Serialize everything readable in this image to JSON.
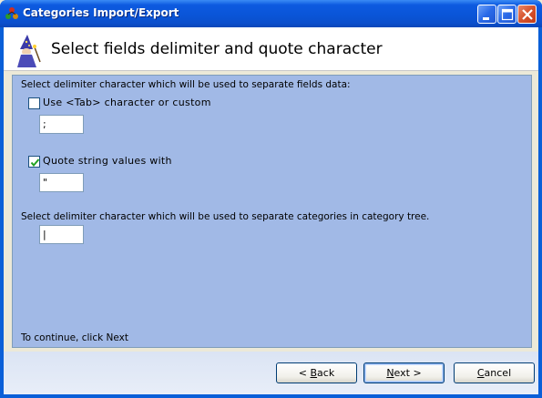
{
  "window": {
    "title": "Categories Import/Export",
    "icons": {
      "app": "tree-app-icon",
      "minimize": "minimize-icon",
      "maximize": "maximize-icon",
      "close": "close-icon"
    }
  },
  "header": {
    "title": "Select fields delimiter and quote character",
    "icon": "wizard-icon"
  },
  "form": {
    "fields_delimiter_label": "Select delimiter character which will be used to separate fields data:",
    "use_tab_label": "Use <Tab> character or custom",
    "use_tab_checked": false,
    "custom_delimiter_value": ";",
    "quote_label": "Quote string values with",
    "quote_checked": true,
    "quote_value": "\"",
    "category_delimiter_label": "Select delimiter character which will be used to separate categories in category tree.",
    "category_delimiter_value": "|",
    "continue_hint": "To continue, click Next"
  },
  "buttons": {
    "back_prefix": "< ",
    "back_key": "B",
    "back_rest": "ack",
    "next_key": "N",
    "next_rest": "ext >",
    "cancel_key": "C",
    "cancel_rest": "ancel"
  }
}
